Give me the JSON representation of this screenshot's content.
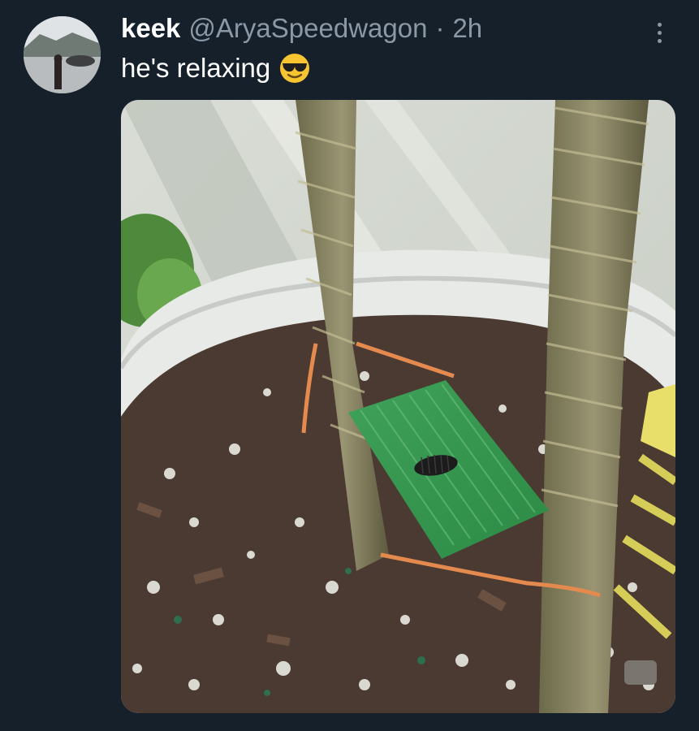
{
  "tweet": {
    "display_name": "keek",
    "handle": "@AryaSpeedwagon",
    "separator": "·",
    "time": "2h",
    "text": "he's relaxing",
    "emoji": "smiling-face-with-sunglasses-icon"
  },
  "colors": {
    "background": "#15202b",
    "primary_text": "#ffffff",
    "secondary_text": "#8b98a5"
  }
}
